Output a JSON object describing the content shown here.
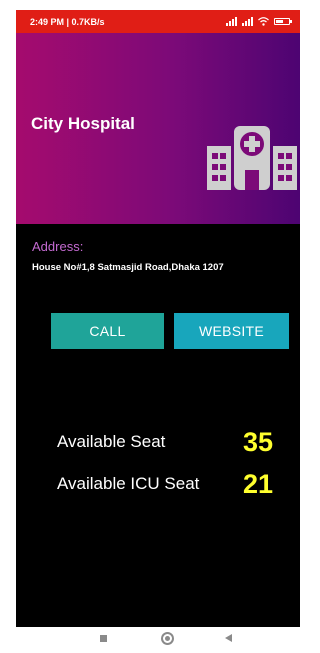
{
  "status_bar": {
    "time_speed": "2:49 PM | 0.7KB/s",
    "battery_percent": 60
  },
  "hero": {
    "title": "City Hospital",
    "icon": "hospital-icon"
  },
  "address": {
    "label": "Address:",
    "text": "House No#1,8 Satmasjid Road,Dhaka 1207"
  },
  "buttons": {
    "call_label": "CALL",
    "website_label": "WEBSITE"
  },
  "seats": {
    "available_label": "Available Seat",
    "available_value": "35",
    "icu_label": "Available ICU Seat",
    "icu_value": "21"
  },
  "colors": {
    "status_bar": "#e01e16",
    "hero_gradient_start": "#a50b6e",
    "hero_gradient_end": "#4d0472",
    "address_label": "#c36ad0",
    "call_button": "#1fa499",
    "website_button": "#18a6bc",
    "seat_value": "#ffff2e"
  }
}
